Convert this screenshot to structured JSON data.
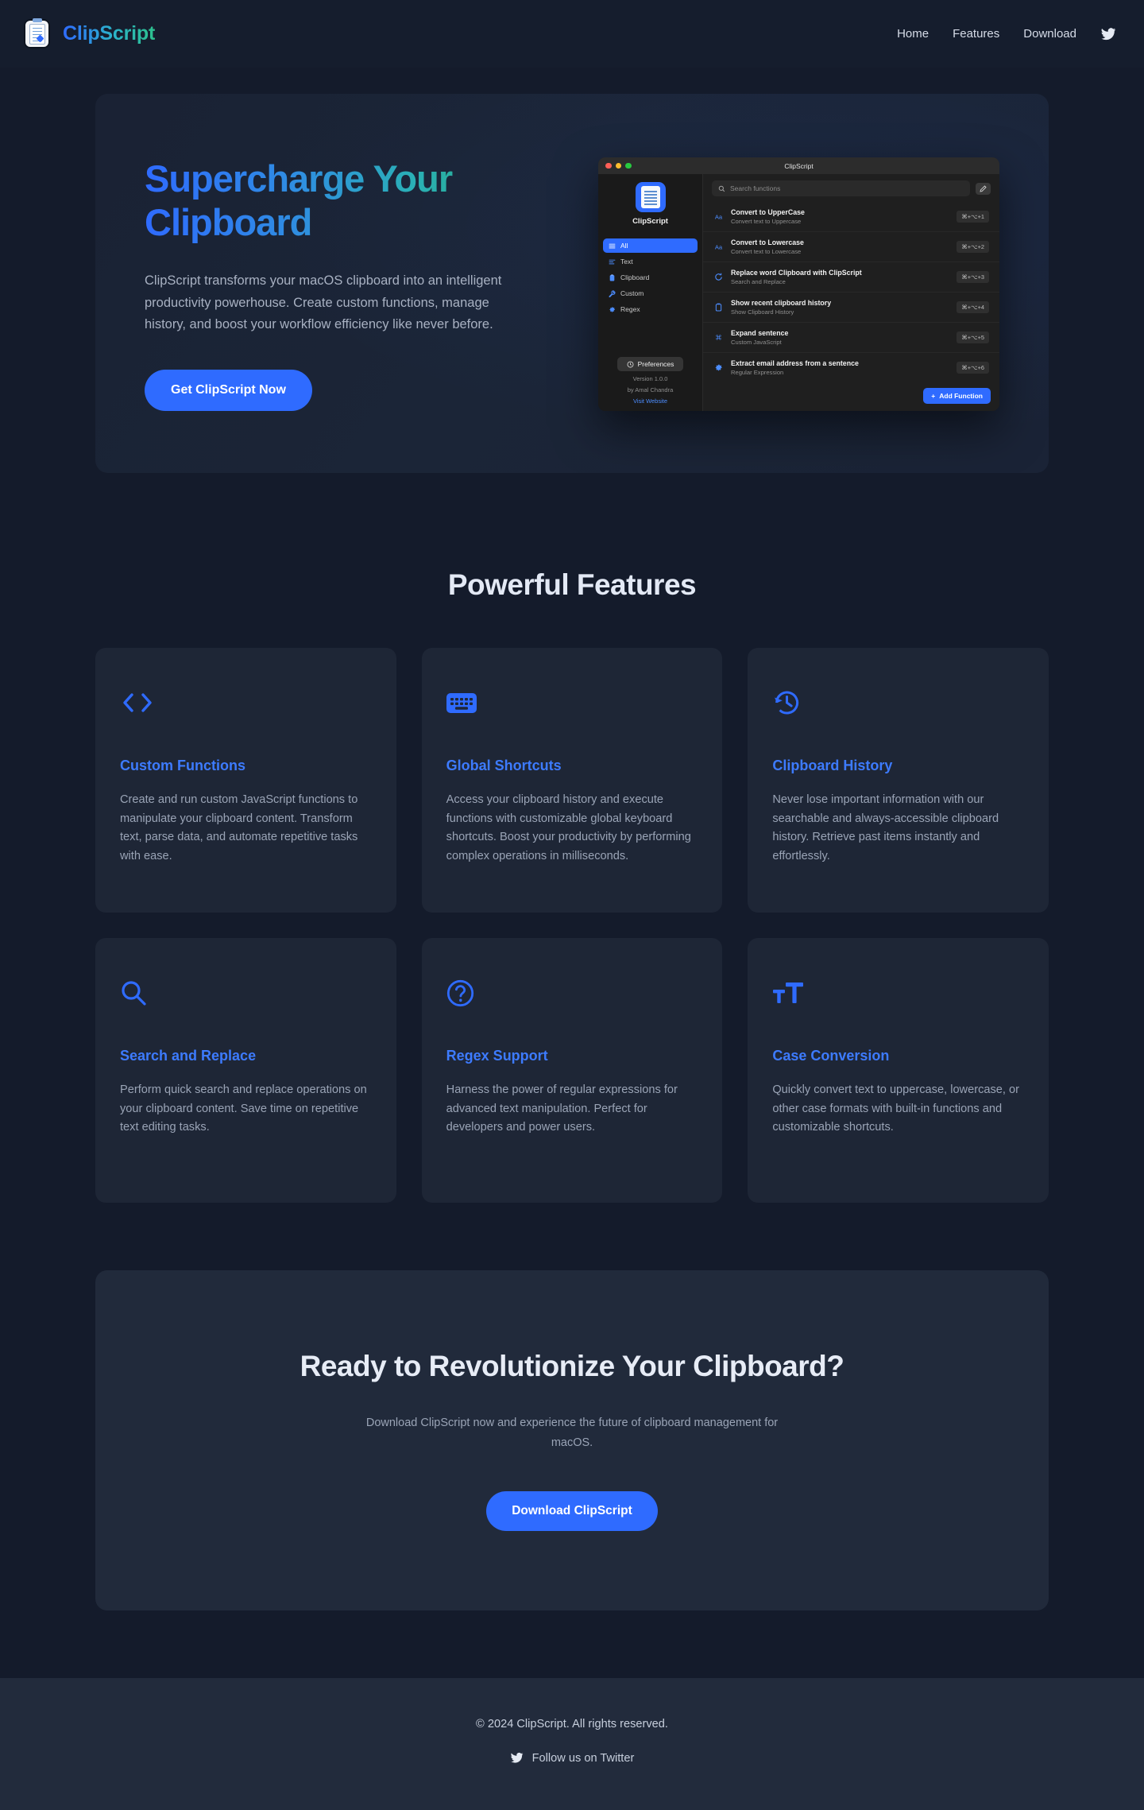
{
  "theme": {
    "page_bg": "#141b2b",
    "card_bg": "#1e2636",
    "accent": "#2f6bff",
    "accent_text": "#3d7bff",
    "gradient_start": "#2f6bff",
    "gradient_end": "#2dc08d",
    "muted_text": "#9aa4b6"
  },
  "header": {
    "logo_icon": "clipboard-document-icon",
    "brand": "ClipScript",
    "nav": [
      {
        "label": "Home",
        "name": "nav-home"
      },
      {
        "label": "Features",
        "name": "nav-features"
      },
      {
        "label": "Download",
        "name": "nav-download"
      }
    ],
    "twitter_icon": "twitter-bird-icon"
  },
  "hero": {
    "title": "Supercharge Your Clipboard",
    "subtitle": "ClipScript transforms your macOS clipboard into an intelligent productivity powerhouse. Create custom functions, manage history, and boost your workflow efficiency like never before.",
    "cta_label": "Get ClipScript Now"
  },
  "app_mockup": {
    "window_title": "ClipScript",
    "traffic_lights": [
      "close-red",
      "minimize-yellow",
      "maximize-green"
    ],
    "sidebar": {
      "app_icon": "clipscript-app-icon",
      "app_name": "ClipScript",
      "items": [
        {
          "label": "All",
          "icon": "list-icon",
          "active": true
        },
        {
          "label": "Text",
          "icon": "text-lines-icon",
          "active": false
        },
        {
          "label": "Clipboard",
          "icon": "clipboard-icon",
          "active": false
        },
        {
          "label": "Custom",
          "icon": "wrench-icon",
          "active": false
        },
        {
          "label": "Regex",
          "icon": "gear-icon",
          "active": false
        }
      ],
      "preferences_label": "Preferences",
      "preferences_icon": "gear-icon",
      "version": "Version 1.0.0",
      "author": "by Amal Chandra",
      "website_link": "Visit Website"
    },
    "search": {
      "placeholder": "Search functions",
      "search_icon": "search-icon",
      "edit_button_icon": "pencil-icon"
    },
    "functions": [
      {
        "name": "Convert to UpperCase",
        "desc": "Convert text to Uppercase",
        "shortcut": "⌘+⌥+1",
        "icon": "aa-case-icon"
      },
      {
        "name": "Convert to Lowercase",
        "desc": "Convert text to Lowercase",
        "shortcut": "⌘+⌥+2",
        "icon": "aa-case-icon"
      },
      {
        "name": "Replace word Clipboard with ClipScript",
        "desc": "Search and Replace",
        "shortcut": "⌘+⌥+3",
        "icon": "refresh-icon"
      },
      {
        "name": "Show recent clipboard history",
        "desc": "Show Clipboard History",
        "shortcut": "⌘+⌥+4",
        "icon": "clipboard-icon"
      },
      {
        "name": "Expand sentence",
        "desc": "Custom JavaScript",
        "shortcut": "⌘+⌥+5",
        "icon": "command-icon"
      },
      {
        "name": "Extract email address from a sentence",
        "desc": "Regular Expression",
        "shortcut": "⌘+⌥+6",
        "icon": "gear-icon"
      }
    ],
    "add_function_label": "Add Function",
    "add_function_icon": "plus-icon"
  },
  "features_section": {
    "title": "Powerful Features",
    "cards": [
      {
        "icon": "code-brackets-icon",
        "title": "Custom Functions",
        "desc": "Create and run custom JavaScript functions to manipulate your clipboard content. Transform text, parse data, and automate repetitive tasks with ease."
      },
      {
        "icon": "keyboard-icon",
        "title": "Global Shortcuts",
        "desc": "Access your clipboard history and execute functions with customizable global keyboard shortcuts. Boost your productivity by performing complex operations in milliseconds."
      },
      {
        "icon": "history-clock-icon",
        "title": "Clipboard History",
        "desc": "Never lose important information with our searchable and always-accessible clipboard history. Retrieve past items instantly and effortlessly."
      },
      {
        "icon": "magnifying-glass-icon",
        "title": "Search and Replace",
        "desc": "Perform quick search and replace operations on your clipboard content. Save time on repetitive text editing tasks."
      },
      {
        "icon": "question-circle-icon",
        "title": "Regex Support",
        "desc": "Harness the power of regular expressions for advanced text manipulation. Perfect for developers and power users."
      },
      {
        "icon": "format-size-tT-icon",
        "title": "Case Conversion",
        "desc": "Quickly convert text to uppercase, lowercase, or other case formats with built-in functions and customizable shortcuts."
      }
    ]
  },
  "cta_section": {
    "title": "Ready to Revolutionize Your Clipboard?",
    "subtitle": "Download ClipScript now and experience the future of clipboard management for macOS.",
    "button_label": "Download ClipScript"
  },
  "footer": {
    "copyright": "© 2024 ClipScript. All rights reserved.",
    "twitter_icon": "twitter-bird-icon",
    "twitter_label": "Follow us on Twitter"
  }
}
